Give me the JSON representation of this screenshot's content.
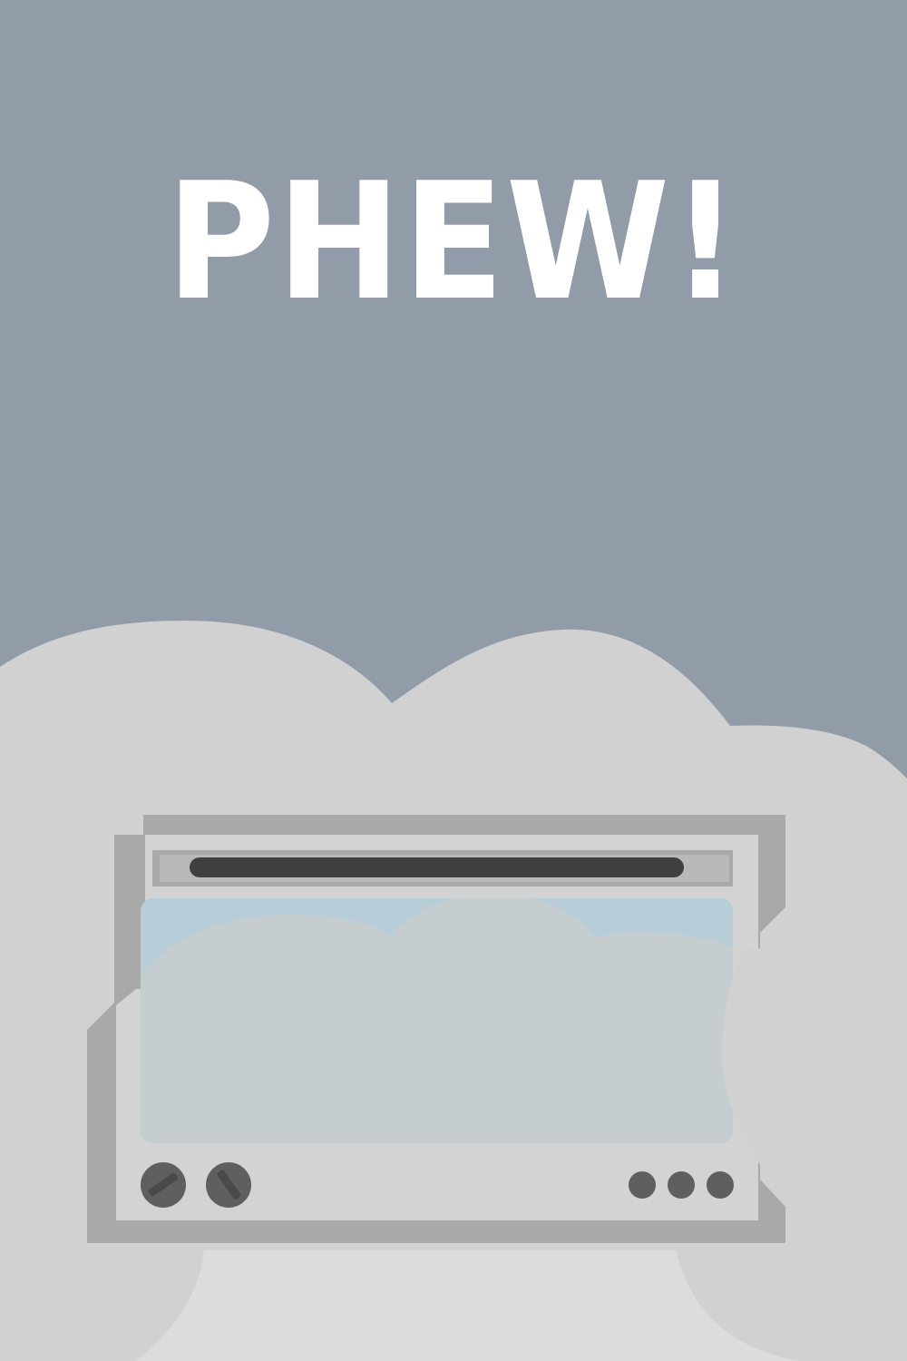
{
  "title": {
    "text": "PHEW!"
  },
  "colors": {
    "background": "#929ca9",
    "smoke": "#d1d1d1",
    "smoke_light": "#dcdcdc",
    "title": "#ffffff",
    "oven_frame_dark": "#a9a9a9",
    "oven_body": "#d3d3d3",
    "oven_handle": "#3f3f3f",
    "oven_window_glass": "#b7cdd8",
    "oven_window_smoke": "#c6cdd1",
    "oven_knob": "#5f5f5f",
    "oven_knob_mark": "#4a4a4a"
  },
  "icons": {
    "smoke": "smoke-cloud-icon",
    "oven": "oven-icon",
    "knob": "dial-knob-icon",
    "light": "indicator-light-icon"
  }
}
